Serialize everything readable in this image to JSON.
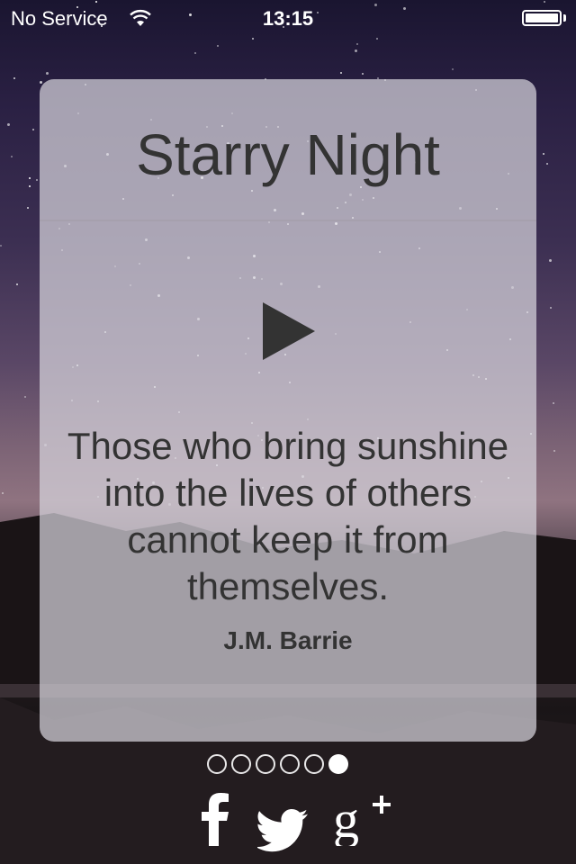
{
  "status_bar": {
    "carrier": "No Service",
    "time": "13:15",
    "wifi_icon": "wifi-icon",
    "battery_icon": "battery-icon"
  },
  "card": {
    "title": "Starry Night",
    "play_icon": "play-icon",
    "quote": "Those who bring sunshine into the lives of others cannot keep it from themselves.",
    "author": "J.M. Barrie"
  },
  "page_indicator": {
    "total": 6,
    "current": 6
  },
  "social": [
    {
      "name": "facebook",
      "icon": "facebook-icon"
    },
    {
      "name": "twitter",
      "icon": "twitter-icon"
    },
    {
      "name": "google-plus",
      "icon": "google-plus-icon"
    }
  ],
  "colors": {
    "card_background": "#d7d4dc",
    "text": "#333333",
    "icon": "#ffffff"
  }
}
